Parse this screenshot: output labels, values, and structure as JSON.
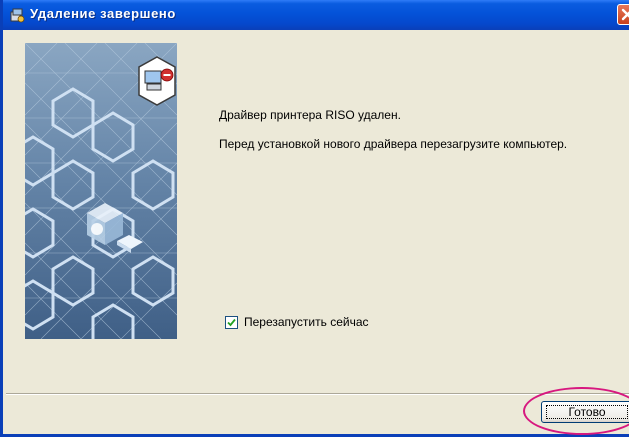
{
  "window": {
    "title": "Удаление завершено",
    "title_icon": "installer-icon",
    "close_icon": "close-icon"
  },
  "banner": {
    "image": "hexagon-installer-banner",
    "badge_icon": "computer-uninstall-icon",
    "cube_icon": "driver-cube-icon"
  },
  "content": {
    "message_line1": "Драйвер принтера RISO удален.",
    "message_line2": "Перед установкой нового драйвера перезагрузите компьютер."
  },
  "restart": {
    "label": "Перезапустить сейчас",
    "checked": true
  },
  "footer": {
    "finish_label": "Готово",
    "highlight_color": "#d7187f"
  },
  "colors": {
    "titlebar": "#0452d8",
    "window_bg": "#ece9d8"
  }
}
